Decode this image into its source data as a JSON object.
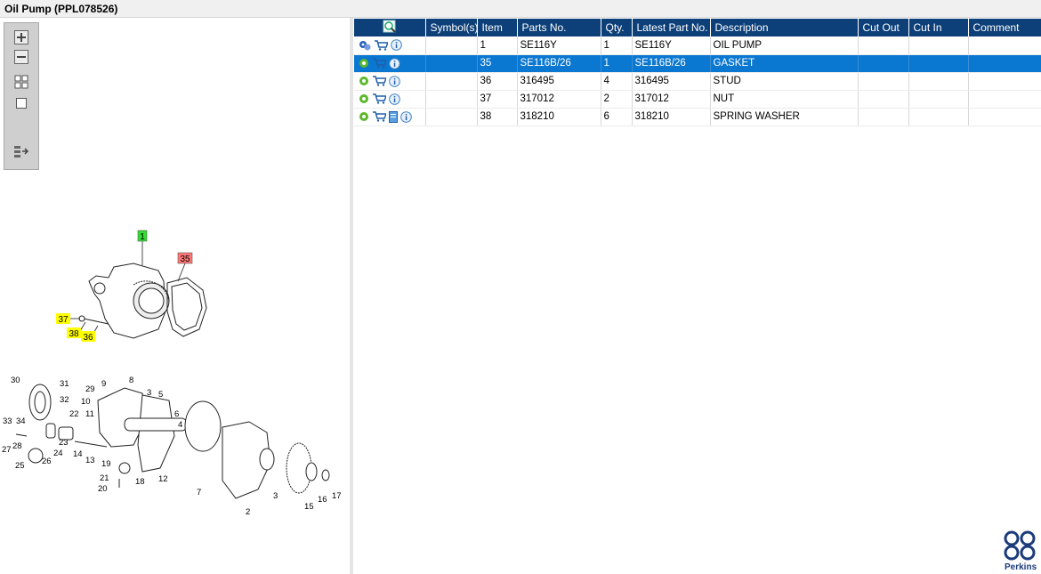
{
  "window": {
    "title": "Oil Pump (PPL078526)"
  },
  "table": {
    "headers": [
      "",
      "Symbol(s)",
      "Item",
      "Parts No.",
      "Qty.",
      "Latest Part No.",
      "Description",
      "Cut Out",
      "Cut In",
      "Comment"
    ],
    "rows": [
      {
        "symbols": "",
        "item": "1",
        "parts_no": "SE116Y",
        "qty": "1",
        "latest": "SE116Y",
        "description": "OIL PUMP",
        "cut_out": "",
        "cut_in": "",
        "comment": "",
        "first_icon": "gears-icon",
        "extra_icon": ""
      },
      {
        "symbols": "",
        "item": "35",
        "parts_no": "SE116B/26",
        "qty": "1",
        "latest": "SE116B/26",
        "description": "GASKET",
        "cut_out": "",
        "cut_in": "",
        "comment": "",
        "first_icon": "gear-icon",
        "extra_icon": ""
      },
      {
        "symbols": "",
        "item": "36",
        "parts_no": "316495",
        "qty": "4",
        "latest": "316495",
        "description": "STUD",
        "cut_out": "",
        "cut_in": "",
        "comment": "",
        "first_icon": "gear-icon",
        "extra_icon": ""
      },
      {
        "symbols": "",
        "item": "37",
        "parts_no": "317012",
        "qty": "2",
        "latest": "317012",
        "description": "NUT",
        "cut_out": "",
        "cut_in": "",
        "comment": "",
        "first_icon": "gear-icon",
        "extra_icon": ""
      },
      {
        "symbols": "",
        "item": "38",
        "parts_no": "318210",
        "qty": "6",
        "latest": "318210",
        "description": "SPRING WASHER",
        "cut_out": "",
        "cut_in": "",
        "comment": "",
        "first_icon": "gear-icon",
        "extra_icon": "document-icon"
      }
    ],
    "selected_index": 1
  },
  "diagram": {
    "callouts_top": [
      {
        "label": "1",
        "color": "#33dd33"
      },
      {
        "label": "35",
        "color": "#ff7777"
      },
      {
        "label": "37",
        "color": "#ffff00"
      },
      {
        "label": "38",
        "color": "#ffff00"
      },
      {
        "label": "36",
        "color": "#ffff00"
      }
    ],
    "labels_bottom": [
      "30",
      "31",
      "29",
      "9",
      "8",
      "10",
      "3",
      "5",
      "32",
      "6",
      "22",
      "4",
      "11",
      "33",
      "34",
      "27",
      "28",
      "23",
      "14",
      "24",
      "13",
      "25",
      "26",
      "19",
      "12",
      "21",
      "18",
      "20",
      "7",
      "2",
      "3",
      "15",
      "16",
      "17"
    ]
  },
  "brand": {
    "name": "Perkins",
    "color": "#1b3b7a"
  },
  "colors": {
    "header": "#0d3f78",
    "selected": "#0a77d1"
  }
}
